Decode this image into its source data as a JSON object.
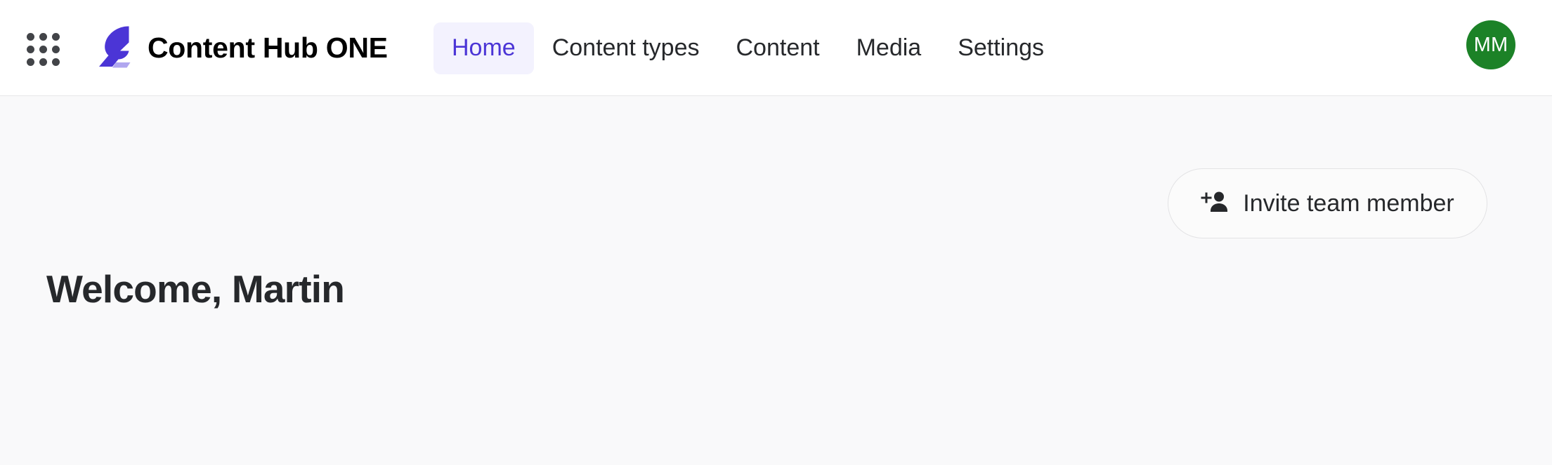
{
  "header": {
    "app_launcher_icon": "apps-grid-icon",
    "logo_icon": "feather-logo-icon",
    "brand_title": "Content Hub ONE",
    "nav": [
      {
        "label": "Home",
        "active": true
      },
      {
        "label": "Content types",
        "active": false
      },
      {
        "label": "Content",
        "active": false
      },
      {
        "label": "Media",
        "active": false
      },
      {
        "label": "Settings",
        "active": false
      }
    ],
    "avatar": {
      "initials": "MM",
      "color": "#1c8227"
    }
  },
  "main": {
    "page_title": "Welcome, Martin",
    "invite_button": {
      "label": "Invite team member",
      "icon": "person-add-icon"
    }
  },
  "colors": {
    "accent": "#4b35d6",
    "accent_soft": "#f3f2fe",
    "header_bg": "#ffffff",
    "body_bg": "#f9f9fa",
    "border": "#e6e6e8",
    "text": "#26282b",
    "avatar_green": "#1c8227"
  }
}
